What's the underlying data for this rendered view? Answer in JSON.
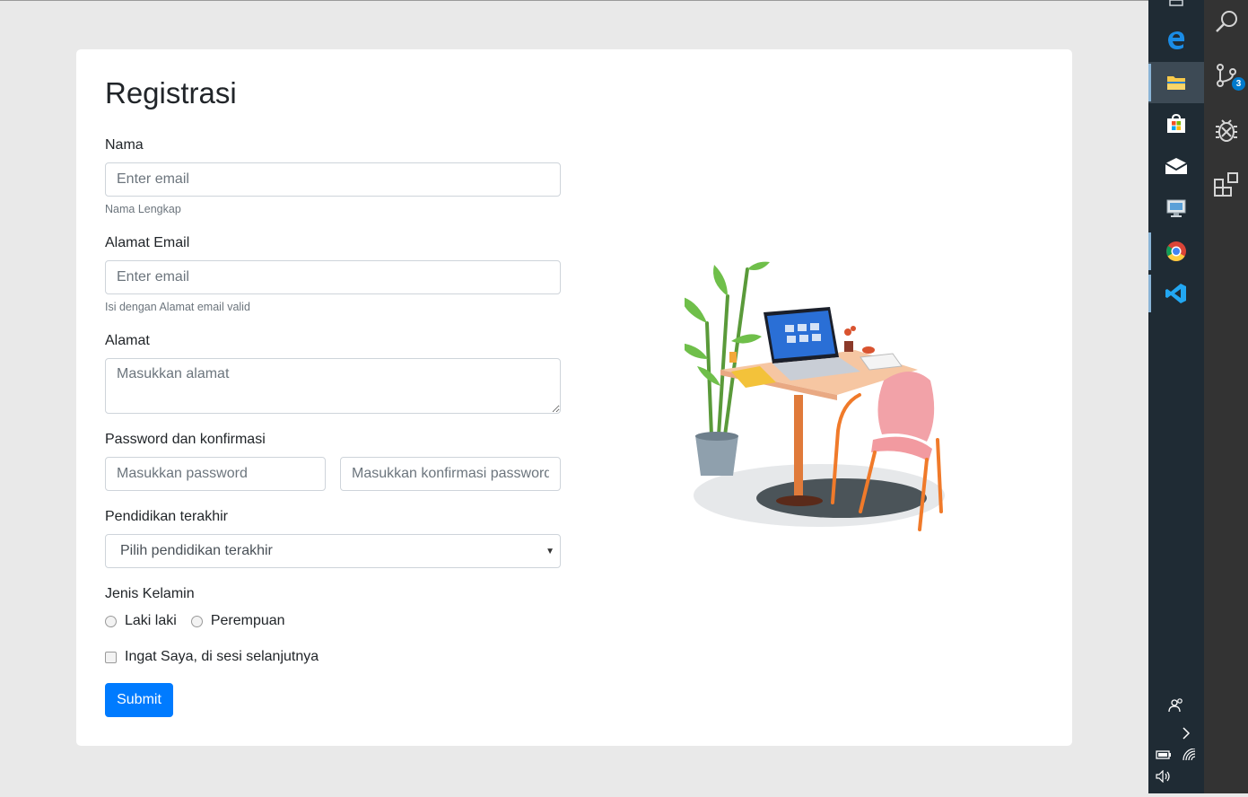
{
  "form": {
    "title": "Registrasi",
    "nama": {
      "label": "Nama",
      "placeholder": "Enter email",
      "help": "Nama Lengkap"
    },
    "email": {
      "label": "Alamat Email",
      "placeholder": "Enter email",
      "help": "Isi dengan Alamat email valid"
    },
    "alamat": {
      "label": "Alamat",
      "placeholder": "Masukkan alamat"
    },
    "password": {
      "label": "Password dan konfirmasi",
      "placeholder": "Masukkan password",
      "confirm_placeholder": "Masukkan konfirmasi password"
    },
    "pendidikan": {
      "label": "Pendidikan terakhir",
      "selected": "Pilih pendidikan terakhir"
    },
    "gender": {
      "label": "Jenis Kelamin",
      "options": [
        "Laki laki",
        "Perempuan"
      ]
    },
    "remember": {
      "label": "Ingat Saya, di sesi selanjutnya"
    },
    "submit_label": "Submit"
  },
  "illustration": {
    "name": "desk-laptop-chair-plant-illustration"
  },
  "taskbar": {
    "icons": [
      "edge-icon",
      "file-explorer-icon",
      "store-icon",
      "mail-icon",
      "remote-desktop-icon",
      "chrome-icon",
      "vscode-icon"
    ],
    "active": "file-explorer-icon",
    "tray": [
      "people-icon",
      "show-hidden-icons-chevron",
      "battery-icon",
      "wifi-icon",
      "volume-icon"
    ]
  },
  "activity_bar": {
    "icons": [
      "search-icon",
      "source-control-icon",
      "debug-icon",
      "extensions-icon"
    ],
    "source_control_badge": "3"
  },
  "colors": {
    "primary": "#007bff",
    "taskbar": "#1f2b34",
    "vscode_activity": "#333333",
    "badge": "#007acc"
  }
}
